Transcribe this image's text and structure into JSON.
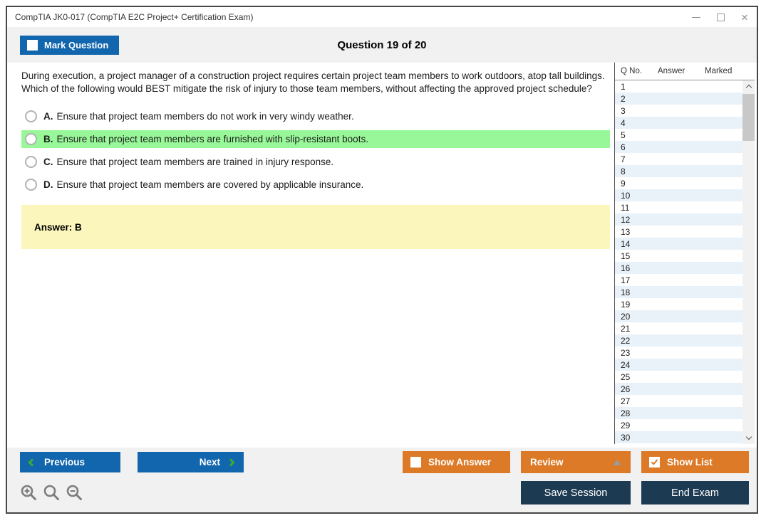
{
  "window": {
    "title": "CompTIA JK0-017 (CompTIA E2C Project+ Certification Exam)"
  },
  "header": {
    "mark_question": "Mark Question",
    "question_counter": "Question 19 of 20"
  },
  "question": {
    "text": "During execution, a project manager of a construction project requires certain project team members to work outdoors, atop tall buildings. Which of the following would BEST mitigate the risk of injury to those team members, without affecting the approved project schedule?",
    "options": [
      {
        "letter": "A.",
        "text": "Ensure that project team members do not work in very windy weather.",
        "highlighted": false
      },
      {
        "letter": "B.",
        "text": "Ensure that project team members are furnished with slip-resistant boots.",
        "highlighted": true
      },
      {
        "letter": "C.",
        "text": "Ensure that project team members are trained in injury response.",
        "highlighted": false
      },
      {
        "letter": "D.",
        "text": "Ensure that project team members are covered by applicable insurance.",
        "highlighted": false
      }
    ],
    "answer_label": "Answer: B"
  },
  "question_list": {
    "columns": [
      "Q No.",
      "Answer",
      "Marked"
    ],
    "rows": [
      {
        "q_no": "1",
        "answer": "",
        "marked": ""
      },
      {
        "q_no": "2",
        "answer": "",
        "marked": ""
      },
      {
        "q_no": "3",
        "answer": "",
        "marked": ""
      },
      {
        "q_no": "4",
        "answer": "",
        "marked": ""
      },
      {
        "q_no": "5",
        "answer": "",
        "marked": ""
      },
      {
        "q_no": "6",
        "answer": "",
        "marked": ""
      },
      {
        "q_no": "7",
        "answer": "",
        "marked": ""
      },
      {
        "q_no": "8",
        "answer": "",
        "marked": ""
      },
      {
        "q_no": "9",
        "answer": "",
        "marked": ""
      },
      {
        "q_no": "10",
        "answer": "",
        "marked": ""
      },
      {
        "q_no": "11",
        "answer": "",
        "marked": ""
      },
      {
        "q_no": "12",
        "answer": "",
        "marked": ""
      },
      {
        "q_no": "13",
        "answer": "",
        "marked": ""
      },
      {
        "q_no": "14",
        "answer": "",
        "marked": ""
      },
      {
        "q_no": "15",
        "answer": "",
        "marked": ""
      },
      {
        "q_no": "16",
        "answer": "",
        "marked": ""
      },
      {
        "q_no": "17",
        "answer": "",
        "marked": ""
      },
      {
        "q_no": "18",
        "answer": "",
        "marked": ""
      },
      {
        "q_no": "19",
        "answer": "",
        "marked": ""
      },
      {
        "q_no": "20",
        "answer": "",
        "marked": ""
      },
      {
        "q_no": "21",
        "answer": "",
        "marked": ""
      },
      {
        "q_no": "22",
        "answer": "",
        "marked": ""
      },
      {
        "q_no": "23",
        "answer": "",
        "marked": ""
      },
      {
        "q_no": "24",
        "answer": "",
        "marked": ""
      },
      {
        "q_no": "25",
        "answer": "",
        "marked": ""
      },
      {
        "q_no": "26",
        "answer": "",
        "marked": ""
      },
      {
        "q_no": "27",
        "answer": "",
        "marked": ""
      },
      {
        "q_no": "28",
        "answer": "",
        "marked": ""
      },
      {
        "q_no": "29",
        "answer": "",
        "marked": ""
      },
      {
        "q_no": "30",
        "answer": "",
        "marked": ""
      }
    ]
  },
  "footer": {
    "previous": "Previous",
    "next": "Next",
    "show_answer": "Show Answer",
    "review": "Review",
    "show_list": "Show List",
    "save_session": "Save Session",
    "end_exam": "End Exam"
  },
  "colors": {
    "primary_blue": "#1266ae",
    "accent_orange": "#dd7a27",
    "dark_navy": "#1c3a52",
    "highlight_green": "#98f798",
    "answer_yellow": "#fbf6bc",
    "chevron_green": "#3aaa35",
    "header_strip_gray": "#f1f1f1",
    "row_stripe_blue": "#eaf2f9"
  }
}
